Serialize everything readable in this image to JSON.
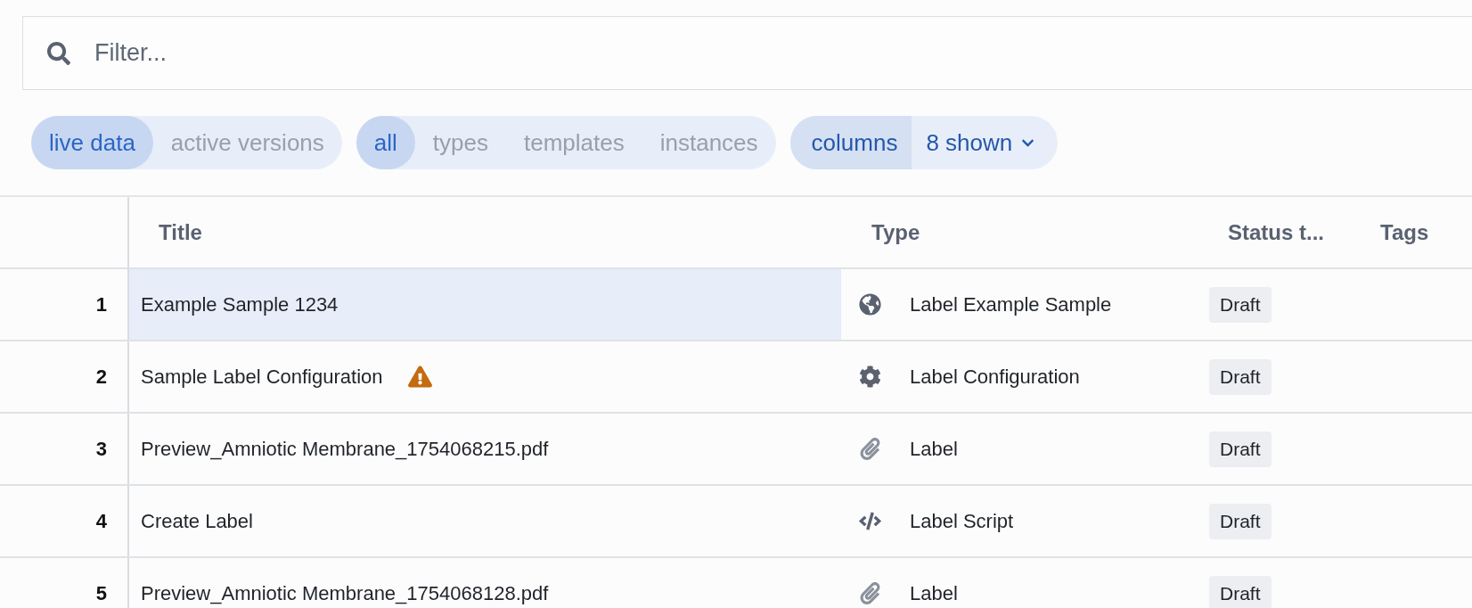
{
  "filter": {
    "placeholder": "Filter..."
  },
  "toggle_groups": [
    {
      "kind": "segmented",
      "options": [
        {
          "label": "live data",
          "selected": true
        },
        {
          "label": "active versions",
          "selected": false
        }
      ]
    },
    {
      "kind": "segmented",
      "options": [
        {
          "label": "all",
          "selected": true
        },
        {
          "label": "types",
          "selected": false
        },
        {
          "label": "templates",
          "selected": false
        },
        {
          "label": "instances",
          "selected": false
        }
      ]
    },
    {
      "kind": "dropdown",
      "label": "columns",
      "value": "8 shown"
    }
  ],
  "table": {
    "columns": [
      "Title",
      "Type",
      "Status t...",
      "Tags"
    ],
    "rows": [
      {
        "number": "1",
        "title": "Example Sample 1234",
        "warning": false,
        "selected": true,
        "type": {
          "kind": "sample",
          "label": "Label Example Sample"
        },
        "status": "Draft"
      },
      {
        "number": "2",
        "title": "Sample Label Configuration",
        "warning": true,
        "selected": false,
        "type": {
          "kind": "configuration",
          "label": "Label Configuration"
        },
        "status": "Draft"
      },
      {
        "number": "3",
        "title": "Preview_Amniotic Membrane_1754068215.pdf",
        "warning": false,
        "selected": false,
        "type": {
          "kind": "file",
          "label": "Label"
        },
        "status": "Draft"
      },
      {
        "number": "4",
        "title": "Create Label",
        "warning": false,
        "selected": false,
        "type": {
          "kind": "script",
          "label": "Label Script"
        },
        "status": "Draft"
      },
      {
        "number": "5",
        "title": "Preview_Amniotic Membrane_1754068128.pdf",
        "warning": false,
        "selected": false,
        "type": {
          "kind": "file",
          "label": "Label"
        },
        "status": "Draft"
      }
    ]
  }
}
